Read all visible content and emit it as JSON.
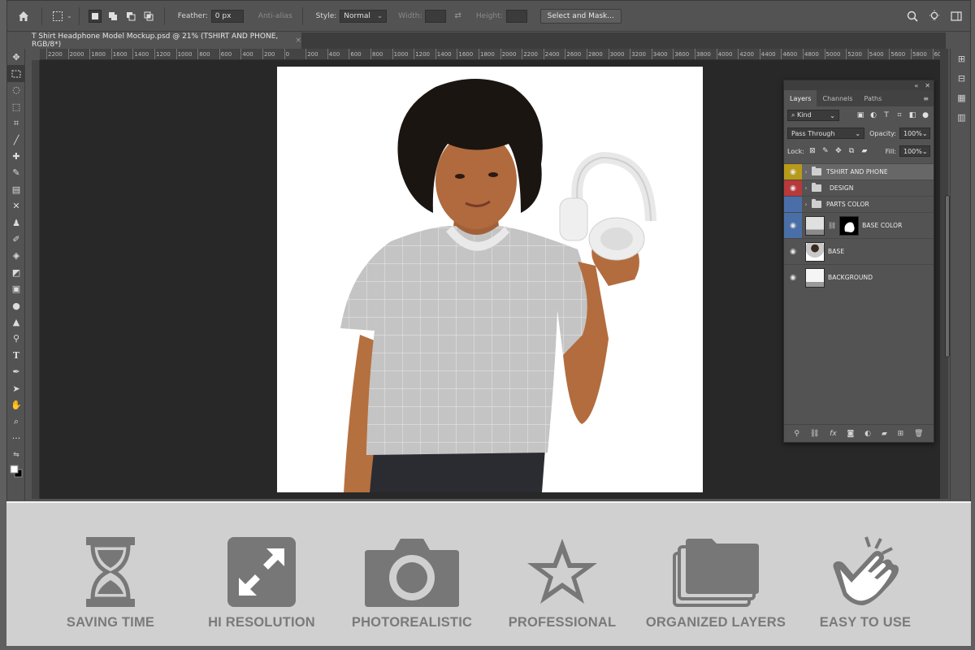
{
  "options_bar": {
    "feather_label": "Feather:",
    "feather_value": "0 px",
    "antialias_label": "Anti-alias",
    "style_label": "Style:",
    "style_value": "Normal",
    "width_label": "Width:",
    "height_label": "Height:",
    "select_mask_label": "Select and Mask..."
  },
  "document_tab": {
    "title": "T Shirt Headphone Model Mockup.psd @ 21% (TSHIRT AND PHONE, RGB/8*)",
    "close": "×"
  },
  "ruler_ticks": [
    "2200",
    "2000",
    "1800",
    "1600",
    "1400",
    "1200",
    "1000",
    "800",
    "600",
    "400",
    "200",
    "0",
    "200",
    "400",
    "600",
    "800",
    "1000",
    "1200",
    "1400",
    "1600",
    "1800",
    "2000",
    "2200",
    "2400",
    "2600",
    "2800",
    "3000",
    "3200",
    "3400",
    "3600",
    "3800",
    "4000",
    "4200",
    "4400",
    "4600",
    "4800",
    "5000",
    "5200",
    "5400",
    "5600",
    "5800",
    "6000",
    "6200"
  ],
  "layers_panel": {
    "tabs": [
      "Layers",
      "Channels",
      "Paths"
    ],
    "kind_label": "Kind",
    "blend_mode": "Pass Through",
    "opacity_label": "Opacity:",
    "opacity_value": "100%",
    "lock_label": "Lock:",
    "fill_label": "Fill:",
    "fill_value": "100%",
    "layers": [
      {
        "name": "TSHIRT AND PHONE",
        "type": "group",
        "color": "#b89a1a",
        "visible": true
      },
      {
        "name": "DESIGN",
        "type": "group",
        "color": "#b8393a",
        "visible": true
      },
      {
        "name": "PARTS COLOR",
        "type": "group",
        "color": "#4a6fa8",
        "visible": false
      },
      {
        "name": "BASE COLOR",
        "type": "layer-mask",
        "color": "#4a6fa8",
        "visible": true
      },
      {
        "name": "BASE",
        "type": "layer",
        "color": "#5a5a5a",
        "visible": true
      },
      {
        "name": "BACKGROUND",
        "type": "layer",
        "color": "#5a5a5a",
        "visible": true
      }
    ]
  },
  "features": [
    {
      "label": "SAVING TIME",
      "icon": "hourglass-icon"
    },
    {
      "label": "HI RESOLUTION",
      "icon": "expand-arrows-icon"
    },
    {
      "label": "PHOTOREALISTIC",
      "icon": "camera-icon"
    },
    {
      "label": "PROFESSIONAL",
      "icon": "star-icon"
    },
    {
      "label": "ORGANIZED LAYERS",
      "icon": "stacked-folders-icon"
    },
    {
      "label": "EASY TO USE",
      "icon": "tap-hand-icon"
    }
  ],
  "colors": {
    "feature_gray": "#7a7a7a",
    "panel_bg": "#535353",
    "canvas_bg": "#282828"
  }
}
